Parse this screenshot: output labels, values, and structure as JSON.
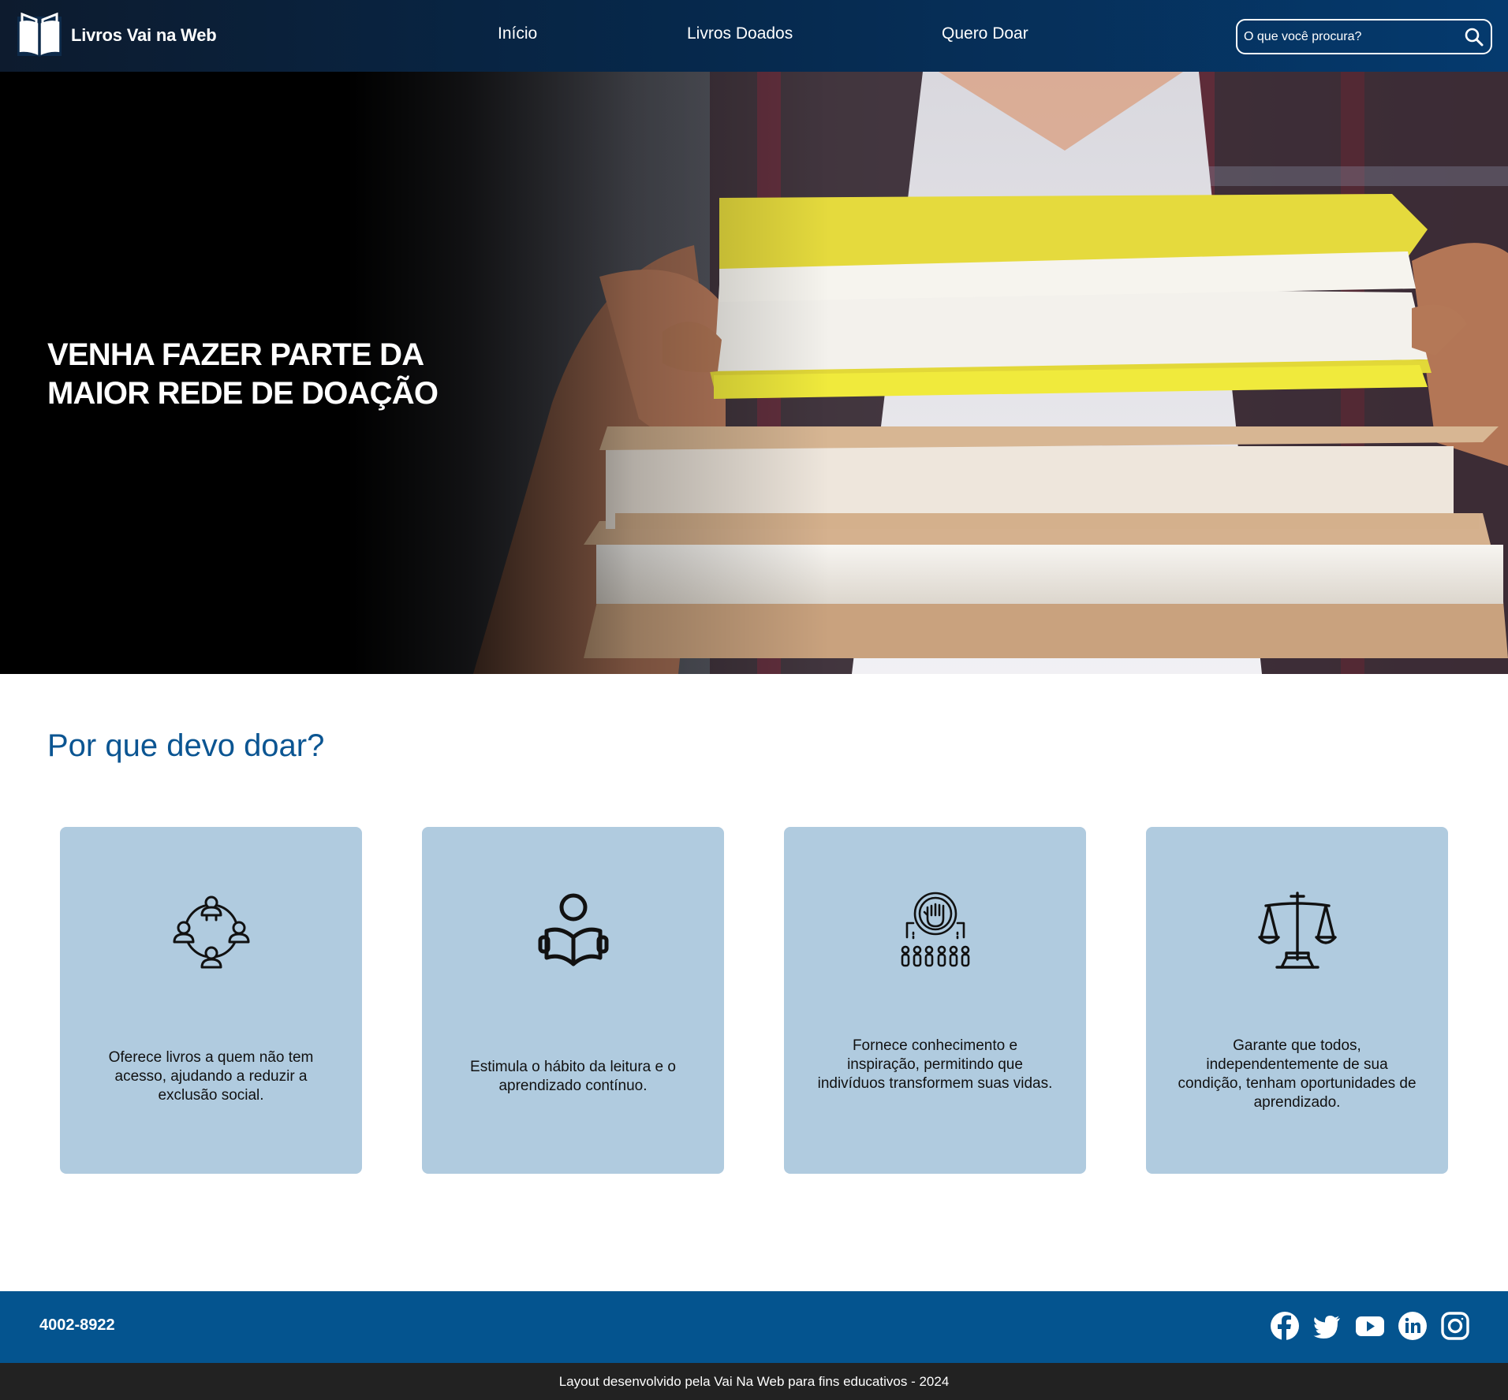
{
  "header": {
    "brand_name": "Livros Vai na Web",
    "nav": [
      "Início",
      "Livros Doados",
      "Quero Doar"
    ],
    "search_placeholder": "O que você procura?"
  },
  "hero": {
    "title_line1": "VENHA FAZER PARTE DA",
    "title_line2": "MAIOR REDE DE DOAÇÃO"
  },
  "why": {
    "title": "Por que devo doar?",
    "cards": [
      {
        "icon": "community-network-icon",
        "text": "Oferece livros a quem não tem acesso, ajudando a reduzir a exclusão social."
      },
      {
        "icon": "person-reading-book-icon",
        "text": "Estimula o hábito da leitura e o aprendizado contínuo."
      },
      {
        "icon": "raised-fist-empowerment-icon",
        "text": "Fornece conhecimento e inspiração, permitindo que indivíduos transformem suas vidas."
      },
      {
        "icon": "justice-scale-icon",
        "text": "Garante que todos, independentemente de sua condição, tenham oportunidades de aprendizado."
      }
    ]
  },
  "footer": {
    "phone": "4002-8922",
    "social": [
      "facebook-icon",
      "twitter-icon",
      "youtube-icon",
      "linkedin-icon",
      "instagram-icon"
    ],
    "copyright": "Layout desenvolvido pela Vai Na Web para fins educativos - 2024"
  },
  "colors": {
    "header_bg": "#06284b",
    "accent_blue": "#0b5592",
    "card_bg": "#b0cbdf",
    "footer_bg": "#04548f",
    "bottom_bar_bg": "#222222"
  }
}
